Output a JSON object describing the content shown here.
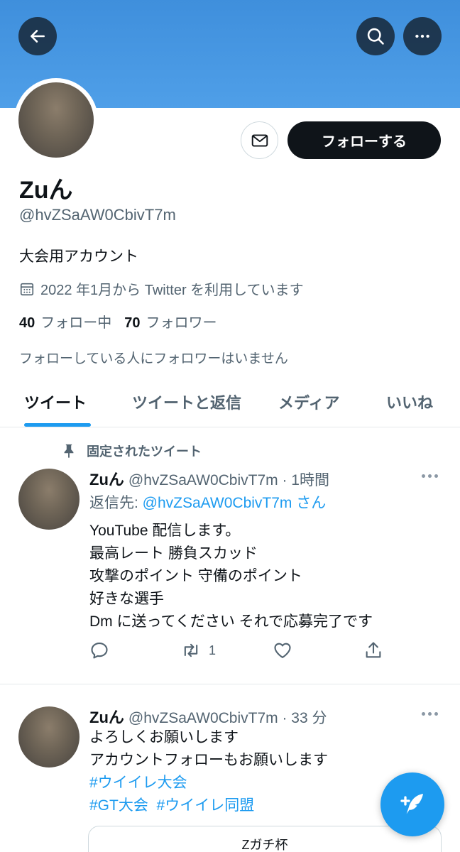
{
  "profile": {
    "display_name": "Zuん",
    "handle": "@hvZSaAW0CbivT7m",
    "bio": "大会用アカウント",
    "joined": "2022 年1月から Twitter を利用しています",
    "following_count": "40",
    "following_label": "フォロー中",
    "followers_count": "70",
    "followers_label": "フォロワー",
    "no_followers_you_know": "フォローしている人にフォロワーはいません",
    "follow_button": "フォローする"
  },
  "tabs": [
    {
      "label": "ツイート",
      "active": true
    },
    {
      "label": "ツイートと返信",
      "active": false
    },
    {
      "label": "メディア",
      "active": false
    },
    {
      "label": "いいね",
      "active": false
    }
  ],
  "tweets": [
    {
      "pinned_label": "固定されたツイート",
      "name": "Zuん",
      "meta": "@hvZSaAW0CbivT7m · 1時間",
      "reply_prefix": "返信先: ",
      "reply_handle": "@hvZSaAW0CbivT7m さん",
      "lines": [
        "YouTube 配信します。",
        "最高レート 勝負スカッド",
        "攻撃のポイント 守備のポイント",
        "好きな選手",
        "Dm に送ってください それで応募完了です"
      ],
      "retweet_count": "1"
    },
    {
      "name": "Zuん",
      "meta": "@hvZSaAW0CbivT7m · 33 分",
      "lines": [
        "よろしくお願いします",
        "アカウントフォローもお願いします"
      ],
      "hashtags": [
        "#ウイイレ大会",
        "#GT大会",
        "#ウイイレ同盟"
      ],
      "card_title": "Zガチ杯"
    }
  ],
  "icons": {
    "back": "arrow-left-icon",
    "search": "search-icon",
    "more": "more-horizontal-icon",
    "message": "envelope-icon",
    "calendar": "calendar-icon",
    "pin": "pin-icon",
    "reply": "reply-icon",
    "retweet": "retweet-icon",
    "like": "heart-icon",
    "share": "share-icon",
    "compose": "compose-tweet-icon"
  },
  "colors": {
    "banner": "#4f9fe8",
    "accent": "#1d9bf0",
    "text": "#0f1419",
    "secondary": "#536471"
  }
}
